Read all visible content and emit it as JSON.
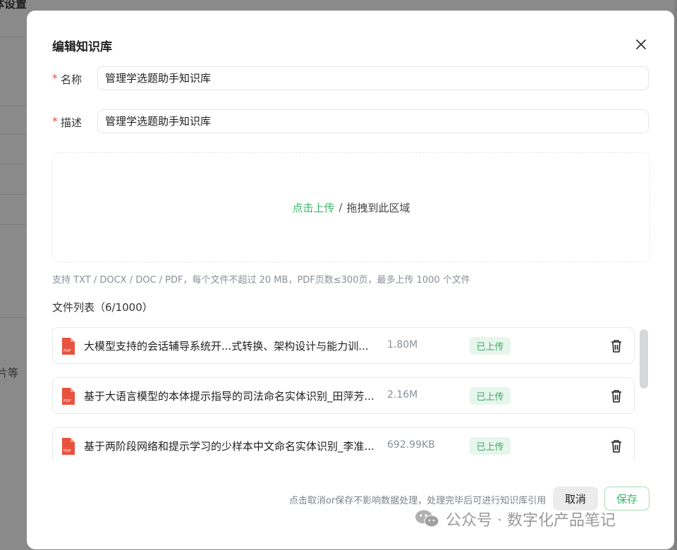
{
  "background": {
    "title": "体设置",
    "side_text": "片等"
  },
  "dialog": {
    "title": "编辑知识库",
    "close_icon": "close-icon"
  },
  "form": {
    "required_mark": "*",
    "name_label": "名称",
    "name_value": "管理学选题助手知识库",
    "desc_label": "描述",
    "desc_value": "管理学选题助手知识库"
  },
  "upload": {
    "link_text": "点击上传",
    "separator": "/",
    "drag_text": "拖拽到此区域",
    "hint": "支持 TXT / DOCX / DOC / PDF，每个文件不超过 20 MB，PDF页数≤300页，最多上传 1000 个文件"
  },
  "file_list": {
    "title": "文件列表（6/1000）",
    "items": [
      {
        "name": "大模型支持的会话辅导系统开...式转换、架构设计与能力训...",
        "size": "1.80M",
        "status": "已上传",
        "icon": "pdf-icon"
      },
      {
        "name": "基于大语言模型的本体提示指导的司法命名实体识别_田萍芳...",
        "size": "2.16M",
        "status": "已上传",
        "icon": "pdf-icon"
      },
      {
        "name": "基于两阶段网络和提示学习的少样本中文命名实体识别_李准...",
        "size": "692.99KB",
        "status": "已上传",
        "icon": "pdf-icon"
      }
    ]
  },
  "footer": {
    "hint": "点击取消or保存不影响数据处理，处理完毕后可进行知识库引用",
    "cancel_label": "取消",
    "save_label": "保存"
  },
  "watermark": {
    "text": "公众号 · 数字化产品笔记",
    "icon": "wechat-icon"
  },
  "colors": {
    "accent": "#3fb66b",
    "required": "#e5483c",
    "status_bg": "#e6f6ec",
    "pdf": "#e8523f"
  }
}
